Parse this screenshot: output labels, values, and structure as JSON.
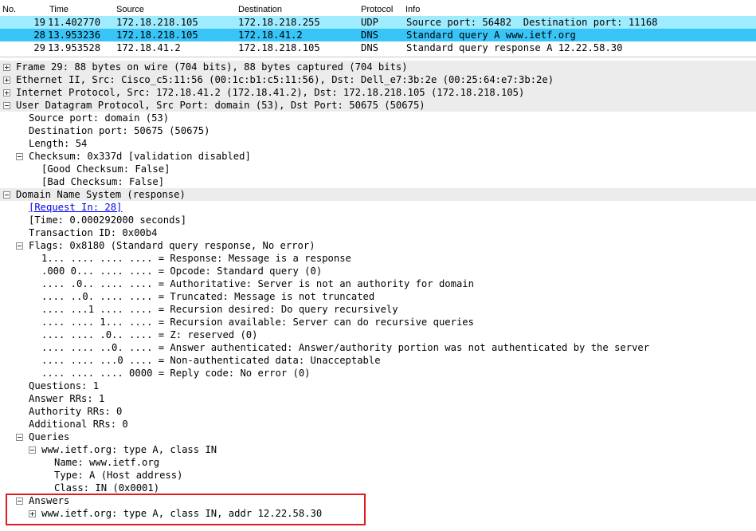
{
  "packet_list": {
    "headers": {
      "no": "No.",
      "time": "Time",
      "source": "Source",
      "destination": "Destination",
      "protocol": "Protocol",
      "info": "Info"
    },
    "rows": [
      {
        "no": "19",
        "time": "11.402770",
        "source": "172.18.218.105",
        "destination": "172.18.218.255",
        "protocol": "UDP",
        "info": "Source port: 56482  Destination port: 11168"
      },
      {
        "no": "28",
        "time": "13.953236",
        "source": "172.18.218.105",
        "destination": "172.18.41.2",
        "protocol": "DNS",
        "info": "Standard query A www.ietf.org"
      },
      {
        "no": "29",
        "time": "13.953528",
        "source": "172.18.41.2",
        "destination": "172.18.218.105",
        "protocol": "DNS",
        "info": "Standard query response A 12.22.58.30"
      }
    ]
  },
  "details": {
    "frame": "Frame 29: 88 bytes on wire (704 bits), 88 bytes captured (704 bits)",
    "ethernet": "Ethernet II, Src: Cisco_c5:11:56 (00:1c:b1:c5:11:56), Dst: Dell_e7:3b:2e (00:25:64:e7:3b:2e)",
    "ip": "Internet Protocol, Src: 172.18.41.2 (172.18.41.2), Dst: 172.18.218.105 (172.18.218.105)",
    "udp": {
      "title": "User Datagram Protocol, Src Port: domain (53), Dst Port: 50675 (50675)",
      "source_port": "Source port: domain (53)",
      "destination_port": "Destination port: 50675 (50675)",
      "length": "Length: 54",
      "checksum": "Checksum: 0x337d [validation disabled]",
      "good_checksum": "[Good Checksum: False]",
      "bad_checksum": "[Bad Checksum: False]"
    },
    "dns": {
      "title": "Domain Name System (response)",
      "request_in": "[Request In: 28]",
      "time": "[Time: 0.000292000 seconds]",
      "transaction_id": "Transaction ID: 0x00b4",
      "flags": {
        "title": "Flags: 0x8180 (Standard query response, No error)",
        "bits": [
          "1... .... .... .... = Response: Message is a response",
          ".000 0... .... .... = Opcode: Standard query (0)",
          ".... .0.. .... .... = Authoritative: Server is not an authority for domain",
          ".... ..0. .... .... = Truncated: Message is not truncated",
          ".... ...1 .... .... = Recursion desired: Do query recursively",
          ".... .... 1... .... = Recursion available: Server can do recursive queries",
          ".... .... .0.. .... = Z: reserved (0)",
          ".... .... ..0. .... = Answer authenticated: Answer/authority portion was not authenticated by the server",
          ".... .... ...0 .... = Non-authenticated data: Unacceptable",
          ".... .... .... 0000 = Reply code: No error (0)"
        ]
      },
      "questions": "Questions: 1",
      "answer_rrs": "Answer RRs: 1",
      "authority_rrs": "Authority RRs: 0",
      "additional_rrs": "Additional RRs: 0",
      "queries": {
        "title": "Queries",
        "entry": "www.ietf.org: type A, class IN",
        "name": "Name: www.ietf.org",
        "type": "Type: A (Host address)",
        "class": "Class: IN (0x0001)"
      },
      "answers": {
        "title": "Answers",
        "entry": "www.ietf.org: type A, class IN, addr 12.22.58.30"
      }
    }
  },
  "colors": {
    "udp_row": "#a0ecff",
    "selected_row": "#38c4f6",
    "section_bg": "#ececec",
    "highlight": "#e01b24",
    "link": "#0000ee"
  }
}
